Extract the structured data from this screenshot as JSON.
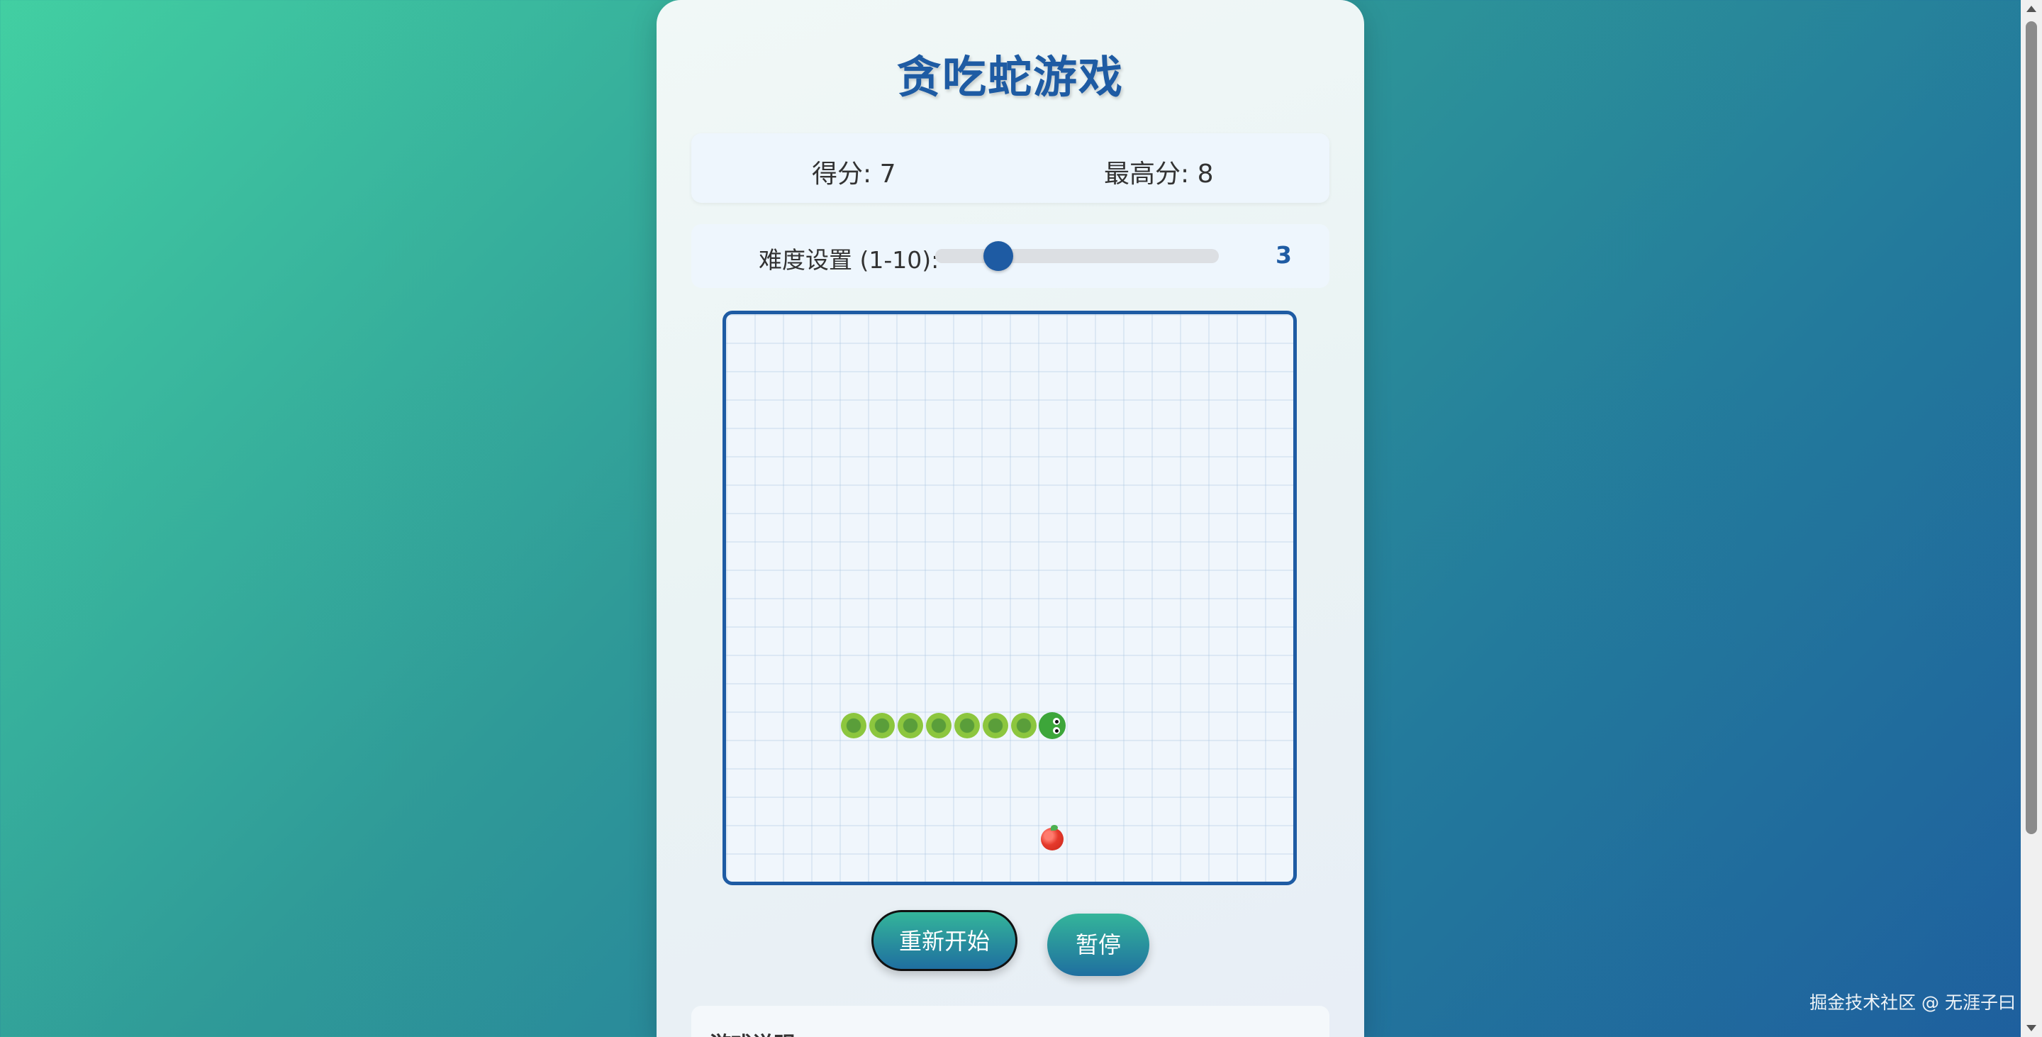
{
  "game": {
    "title": "贪吃蛇游戏",
    "score_label": "得分: 7",
    "score": 7,
    "high_score_label": "最高分: 8",
    "high_score": 8,
    "difficulty_label": "难度设置 (1-10):",
    "difficulty": {
      "value": 3,
      "min": 1,
      "max": 10,
      "display": "3"
    },
    "grid": {
      "cols": 20,
      "rows": 20
    },
    "snake": [
      {
        "col": 11,
        "row": 14
      },
      {
        "col": 10,
        "row": 14
      },
      {
        "col": 9,
        "row": 14
      },
      {
        "col": 8,
        "row": 14
      },
      {
        "col": 7,
        "row": 14
      },
      {
        "col": 6,
        "row": 14
      },
      {
        "col": 5,
        "row": 14
      },
      {
        "col": 4,
        "row": 14
      }
    ],
    "direction": "right",
    "food": {
      "col": 11,
      "row": 18
    },
    "colors": {
      "accent": "#1e5ba3",
      "snake_body": "#8cc63e",
      "snake_head": "#3da63a",
      "food": "#e53a2c"
    }
  },
  "controls": {
    "restart_label": "重新开始",
    "pause_label": "暂停"
  },
  "instructions": {
    "title": "游戏说明"
  },
  "watermark": "掘金技术社区 @ 无涯子曰"
}
